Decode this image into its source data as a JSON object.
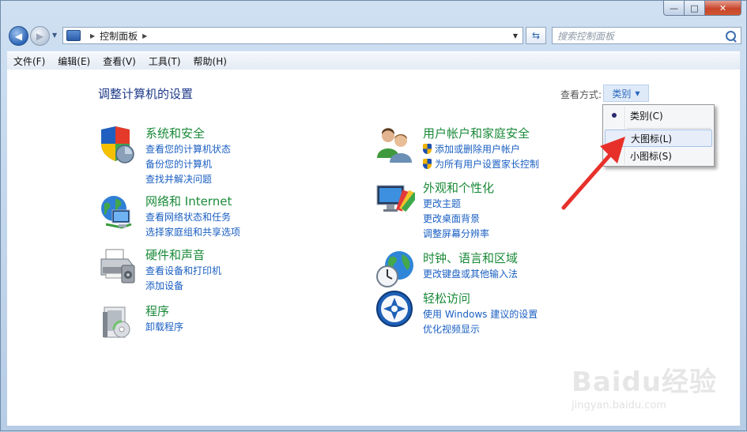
{
  "window": {
    "caption": {
      "minimize": "—",
      "maximize": "□",
      "close": "✕"
    }
  },
  "address": {
    "crumbs": [
      "控制面板"
    ],
    "search_placeholder": "搜索控制面板"
  },
  "menu": [
    "文件(F)",
    "编辑(E)",
    "查看(V)",
    "工具(T)",
    "帮助(H)"
  ],
  "page": {
    "title": "调整计算机的设置",
    "view_by_label": "查看方式:",
    "view_by_value": "类别"
  },
  "categories": [
    {
      "title": "系统和安全",
      "icon": "security-shield-icon",
      "links": [
        "查看您的计算机状态",
        "备份您的计算机",
        "查找并解决问题"
      ]
    },
    {
      "title": "网络和 Internet",
      "icon": "network-globe-icon",
      "links": [
        "查看网络状态和任务",
        "选择家庭组和共享选项"
      ]
    },
    {
      "title": "硬件和声音",
      "icon": "printer-icon",
      "links": [
        "查看设备和打印机",
        "添加设备"
      ]
    },
    {
      "title": "程序",
      "icon": "programs-icon",
      "links": [
        "卸载程序"
      ]
    },
    {
      "title": "用户帐户和家庭安全",
      "icon": "users-icon",
      "links": [
        "添加或删除用户帐户",
        "为所有用户设置家长控制"
      ]
    },
    {
      "title": "外观和个性化",
      "icon": "monitor-icon",
      "links": [
        "更改主题",
        "更改桌面背景",
        "调整屏幕分辨率"
      ]
    },
    {
      "title": "时钟、语言和区域",
      "icon": "clock-globe-icon",
      "links": [
        "更改键盘或其他输入法"
      ]
    },
    {
      "title": "轻松访问",
      "icon": "accessibility-icon",
      "links": [
        "使用 Windows 建议的设置",
        "优化视频显示"
      ]
    }
  ],
  "view_menu": {
    "items": [
      {
        "label": "类别(C)",
        "checked": true
      },
      {
        "label": "大图标(L)",
        "highlighted": true
      },
      {
        "label": "小图标(S)"
      }
    ]
  },
  "watermark": {
    "logo": "Baidu经验",
    "url": "jingyan.baidu.com"
  },
  "colors": {
    "category_title": "#1a8a38",
    "link": "#1a5fc2",
    "page_title": "#1e3a8a",
    "arrow": "#e8302a"
  }
}
